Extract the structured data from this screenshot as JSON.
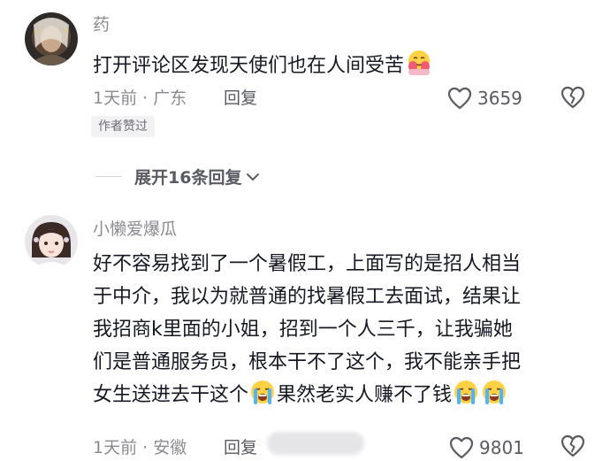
{
  "comments": [
    {
      "username": "药",
      "content": "打开评论区发现天使们也在人间受苦",
      "emoji": "hugging-face-emoji",
      "time_location": "1天前 · 广东",
      "reply_label": "回复",
      "likes": "3659",
      "badge": "作者赞过"
    },
    {
      "username": "小懒爱爆瓜",
      "content_lines": [
        "好不容易找到了一个暑假工，上面写的是招人相当",
        "于中介，我以为就普通的找暑假工去面试，结果让",
        "我招商k里面的小姐，招到一个人三千，让我骗她",
        "们是普通服务员，根本干不了这个，我不能亲手把"
      ],
      "last_line_part1": "女生送进去干这个",
      "last_line_part2": "果然老实人赚不了钱",
      "emoji": "crying-face-emoji",
      "time_location": "1天前 · 安徽",
      "reply_label": "回复",
      "likes": "9801"
    }
  ],
  "expand_replies_label": "展开16条回复",
  "colors": {
    "text_primary": "#161823",
    "text_secondary": "#8a8b91",
    "badge_bg": "#f2f2f4"
  }
}
